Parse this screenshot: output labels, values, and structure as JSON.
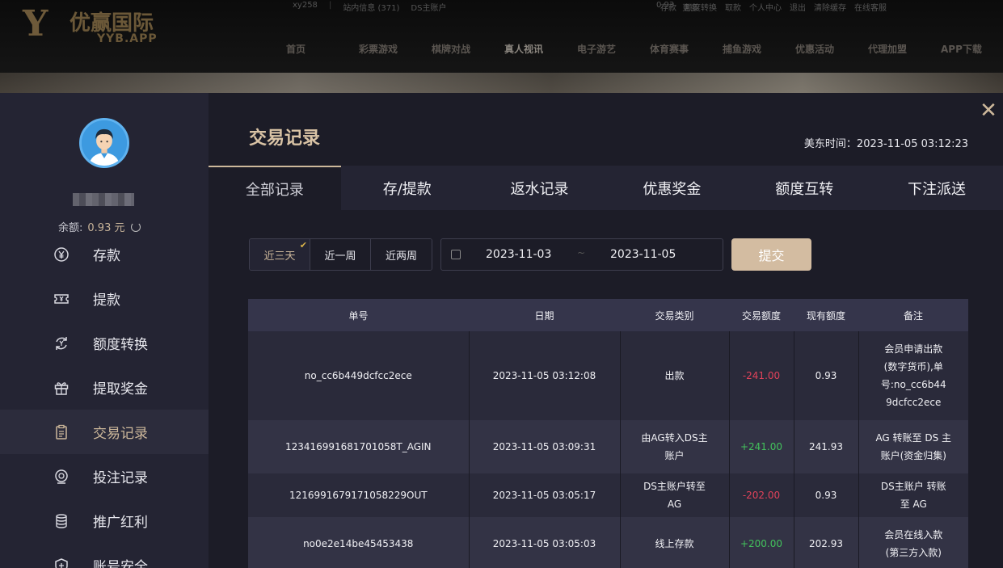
{
  "site": {
    "logo_mark": "Y",
    "logo_name": "优赢国际",
    "logo_sub": "YYB.APP",
    "topbar_left": [
      "xy258",
      "站内信息 (371)",
      "DS主账户"
    ],
    "topbar_mid": [
      "0.93",
      "更多"
    ],
    "topbar_right": [
      "存款",
      "额度转换",
      "取款",
      "个人中心",
      "退出",
      "清除缓存",
      "在线客服"
    ],
    "nav": [
      "首页",
      "彩票游戏",
      "棋牌对战",
      "真人视讯",
      "电子游艺",
      "体育赛事",
      "捕鱼游戏",
      "优惠活动",
      "代理加盟",
      "APP下载"
    ]
  },
  "sidebar": {
    "username": "xy258",
    "balance_label": "余额:",
    "balance_value": "0.93 元",
    "items": [
      {
        "label": "存款",
        "icon": "yen-circle-icon"
      },
      {
        "label": "提款",
        "icon": "ticket-icon"
      },
      {
        "label": "额度转换",
        "icon": "exchange-icon"
      },
      {
        "label": "提取奖金",
        "icon": "gift-icon"
      },
      {
        "label": "交易记录",
        "icon": "clipboard-icon"
      },
      {
        "label": "投注记录",
        "icon": "bet-record-icon"
      },
      {
        "label": "推广红利",
        "icon": "coins-icon"
      },
      {
        "label": "账号安全",
        "icon": "shield-icon"
      }
    ]
  },
  "header": {
    "title": "交易记录",
    "time_label": "美东时间：",
    "time_value": "2023-11-05 03:12:23"
  },
  "tabs": [
    "全部记录",
    "存/提款",
    "返水记录",
    "优惠奖金",
    "额度互转",
    "下注派送"
  ],
  "filters": {
    "ranges": [
      "近三天",
      "近一周",
      "近两周"
    ],
    "start_date": "2023-11-03",
    "end_date": "2023-11-05",
    "separator": "~",
    "submit": "提交"
  },
  "table": {
    "headers": [
      "单号",
      "日期",
      "交易类别",
      "交易额度",
      "现有额度",
      "备注"
    ],
    "rows": [
      {
        "id": "no_cc6b449dcfcc2ece",
        "date": "2023-11-05 03:12:08",
        "type": "出款",
        "amount": "-241.00",
        "balance": "0.93",
        "note": "会员申请出款(数字货币),单号:no_cc6b449dcfcc2ece"
      },
      {
        "id": "123416991681701058T_AGIN",
        "date": "2023-11-05 03:09:31",
        "type": "由AG转入DS主账户",
        "amount": "+241.00",
        "balance": "241.93",
        "note": "AG 转账至 DS 主账户(资金归集)"
      },
      {
        "id": "121699167917105822​9OUT",
        "date": "2023-11-05 03:05:17",
        "type": "DS主账户转至AG",
        "amount": "-202.00",
        "balance": "0.93",
        "note": "DS主账户 转账至 AG"
      },
      {
        "id": "no0e2e14be45453438",
        "date": "2023-11-05 03:05:03",
        "type": "线上存款",
        "amount": "+200.00",
        "balance": "202.93",
        "note": "会员在线入款(第三方入款)"
      }
    ]
  },
  "colors": {
    "accent": "#cdb89b",
    "negative": "#e0425a",
    "positive": "#43c25c"
  }
}
